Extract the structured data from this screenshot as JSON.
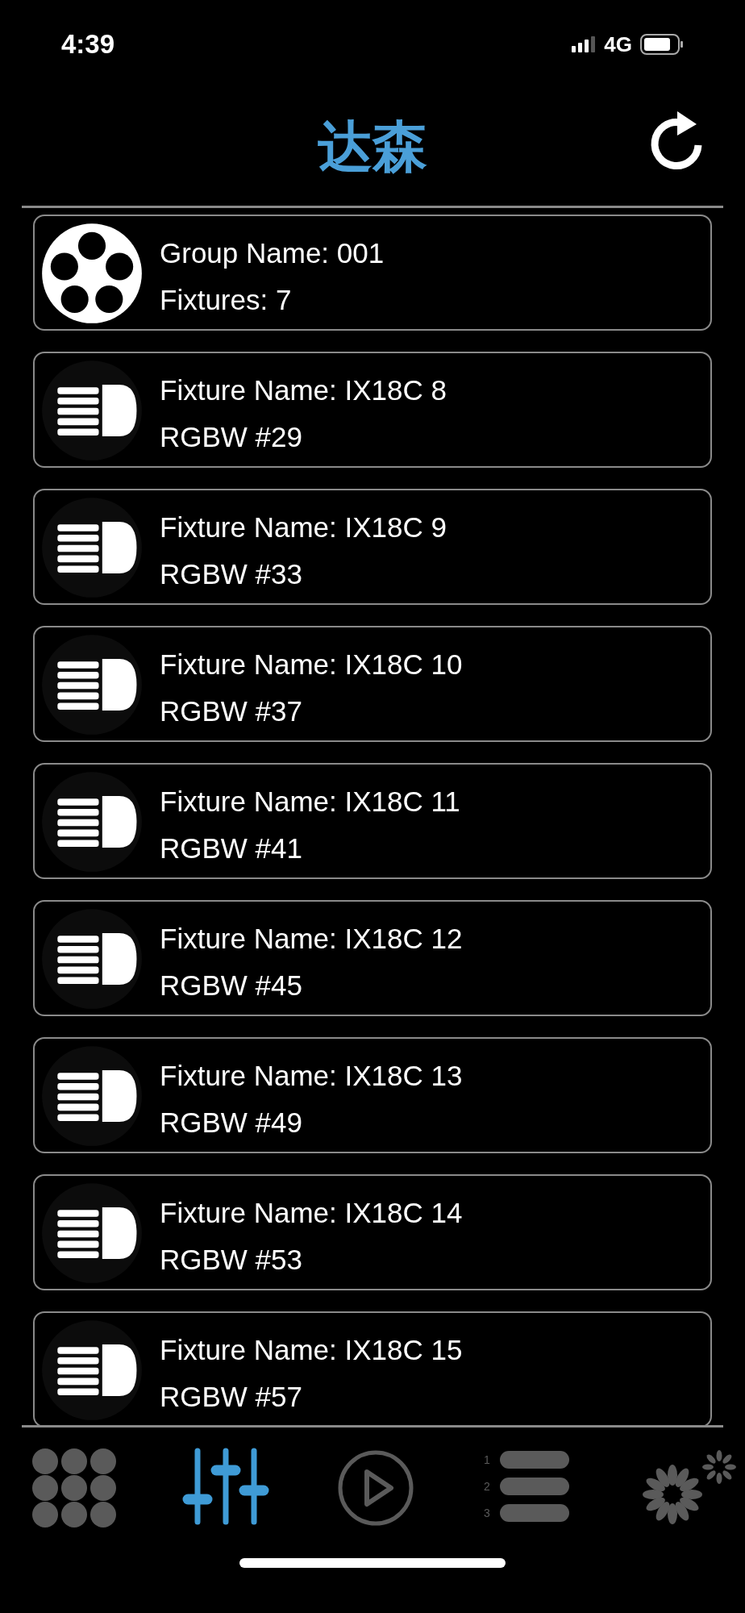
{
  "status_bar": {
    "time": "4:39",
    "network": "4G"
  },
  "header": {
    "title": "达森"
  },
  "items": [
    {
      "kind": "group",
      "line1": "Group Name: 001",
      "line2": "Fixtures: 7"
    },
    {
      "kind": "fixture",
      "line1": "Fixture Name: IX18C 8",
      "line2": "RGBW #29"
    },
    {
      "kind": "fixture",
      "line1": "Fixture Name: IX18C 9",
      "line2": "RGBW #33"
    },
    {
      "kind": "fixture",
      "line1": "Fixture Name: IX18C 10",
      "line2": "RGBW #37"
    },
    {
      "kind": "fixture",
      "line1": "Fixture Name: IX18C 11",
      "line2": "RGBW #41"
    },
    {
      "kind": "fixture",
      "line1": "Fixture Name: IX18C 12",
      "line2": "RGBW #45"
    },
    {
      "kind": "fixture",
      "line1": "Fixture Name: IX18C 13",
      "line2": "RGBW #49"
    },
    {
      "kind": "fixture",
      "line1": "Fixture Name: IX18C 14",
      "line2": "RGBW #53"
    },
    {
      "kind": "fixture",
      "line1": "Fixture Name: IX18C 15",
      "line2": "RGBW #57"
    }
  ],
  "tabs": [
    {
      "kind": "grid",
      "selected": false
    },
    {
      "kind": "sliders",
      "selected": true
    },
    {
      "kind": "play",
      "selected": false
    },
    {
      "kind": "list",
      "selected": false,
      "numbers": [
        "1",
        "2",
        "3"
      ]
    },
    {
      "kind": "effects",
      "selected": false
    }
  ]
}
